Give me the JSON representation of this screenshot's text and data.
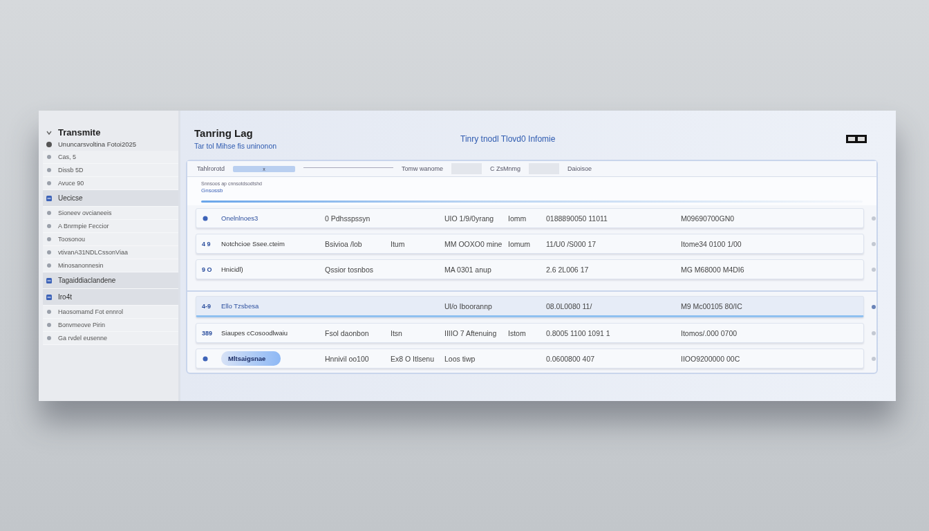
{
  "sidebar": {
    "title": "Transmite",
    "subtitle": "Ununcarsvoltina Fotoi2025",
    "items": [
      {
        "label": "Cas, 5",
        "selected": false
      },
      {
        "label": "Dissb 5D",
        "selected": false
      },
      {
        "label": "Avuce 90",
        "selected": false
      },
      {
        "label": "Uecicse",
        "selected": true
      },
      {
        "label": "Sioneev ovcianeeis",
        "selected": false
      },
      {
        "label": "A Bnrmpie Feccior",
        "selected": false
      },
      {
        "label": "Toosonou",
        "selected": false
      },
      {
        "label": "vtivanA31NDLCssonViaa",
        "selected": false
      },
      {
        "label": "Minosanonnesin",
        "selected": false
      },
      {
        "label": "Tagaiddiaclandene",
        "selected": true
      },
      {
        "label": "Iro4t",
        "selected": true
      },
      {
        "label": "Haosomamd Fot ennrol",
        "selected": false
      },
      {
        "label": "Bonvmeove Pirin",
        "selected": false
      },
      {
        "label": "Ga rvdel eusenne",
        "selected": false
      }
    ]
  },
  "header": {
    "title": "Tanring Lag",
    "subtitle": "Tar tol Mihse fis  uninonon",
    "center": "Tinry tnodl Tlovd0 Infomie"
  },
  "filter_bar": {
    "label": "Tahlrorotd",
    "field": {
      "value": "x"
    },
    "segments": [
      "Tomw wanome",
      "C ZsMnmg",
      "Daioisoe"
    ]
  },
  "panel": {
    "caption": "Snnsoos ap cnnsotdsodtshd",
    "heading": "Gnsossb"
  },
  "groups": [
    {
      "rows": [
        {
          "kind": "plain",
          "selected": false,
          "code": "",
          "name": "Onelnlnoes3",
          "column_3": "0 Pdhsspssyn",
          "column_5": "UIO 1/9/0yrang",
          "column_6": "Iomm",
          "column_7": "0188890050 11011",
          "column_8": "M09690700GN0"
        },
        {
          "kind": "plain",
          "selected": false,
          "code": "4 9",
          "name": "Notchcioe Ssee.cteim",
          "column_3": "Bsivioa /lob",
          "column_4": "Itum",
          "column_5": "MM OOXO0 mine",
          "column_6": "Iomum",
          "column_7": "11/U0 /S000 17",
          "column_8": "Itome34 0100 1/00"
        },
        {
          "kind": "plain",
          "selected": false,
          "code": "9 O",
          "name": "Hnicidl)",
          "column_3": "Qssior tosnbos",
          "column_5": "MA 0301 anup",
          "column_7": "2.6 2L006 17",
          "column_8": "MG M68000 M4DI6"
        }
      ]
    },
    {
      "rows": [
        {
          "kind": "plain",
          "selected": true,
          "code": "4-9",
          "name": "Ello Tzsbesa",
          "column_5": "Ul/o Iboorannp",
          "column_7": "08.0L0080 11/",
          "column_8": "M9 Mc00105 80/IC"
        },
        {
          "kind": "plain",
          "selected": false,
          "code": "389",
          "name": "Siaupes cCosoodlwaiu",
          "column_3": "Fsol daonbon",
          "column_4": "Itsn",
          "column_5": "IIIIO 7 Aftenuing",
          "column_6": "Istom",
          "column_7": "0.8005 1100 1091 1",
          "column_8": "Itomos/.000 0700"
        },
        {
          "kind": "chip",
          "selected": false,
          "code": "",
          "name": "Mltsaigsnae",
          "column_3": "Hnnivil oo100",
          "column_4": "Ex8 O Itlsenu",
          "column_5": "Loos tiwp",
          "column_7": "0.0600800 407",
          "column_8": "IIOO9200000 00C"
        }
      ]
    }
  ]
}
